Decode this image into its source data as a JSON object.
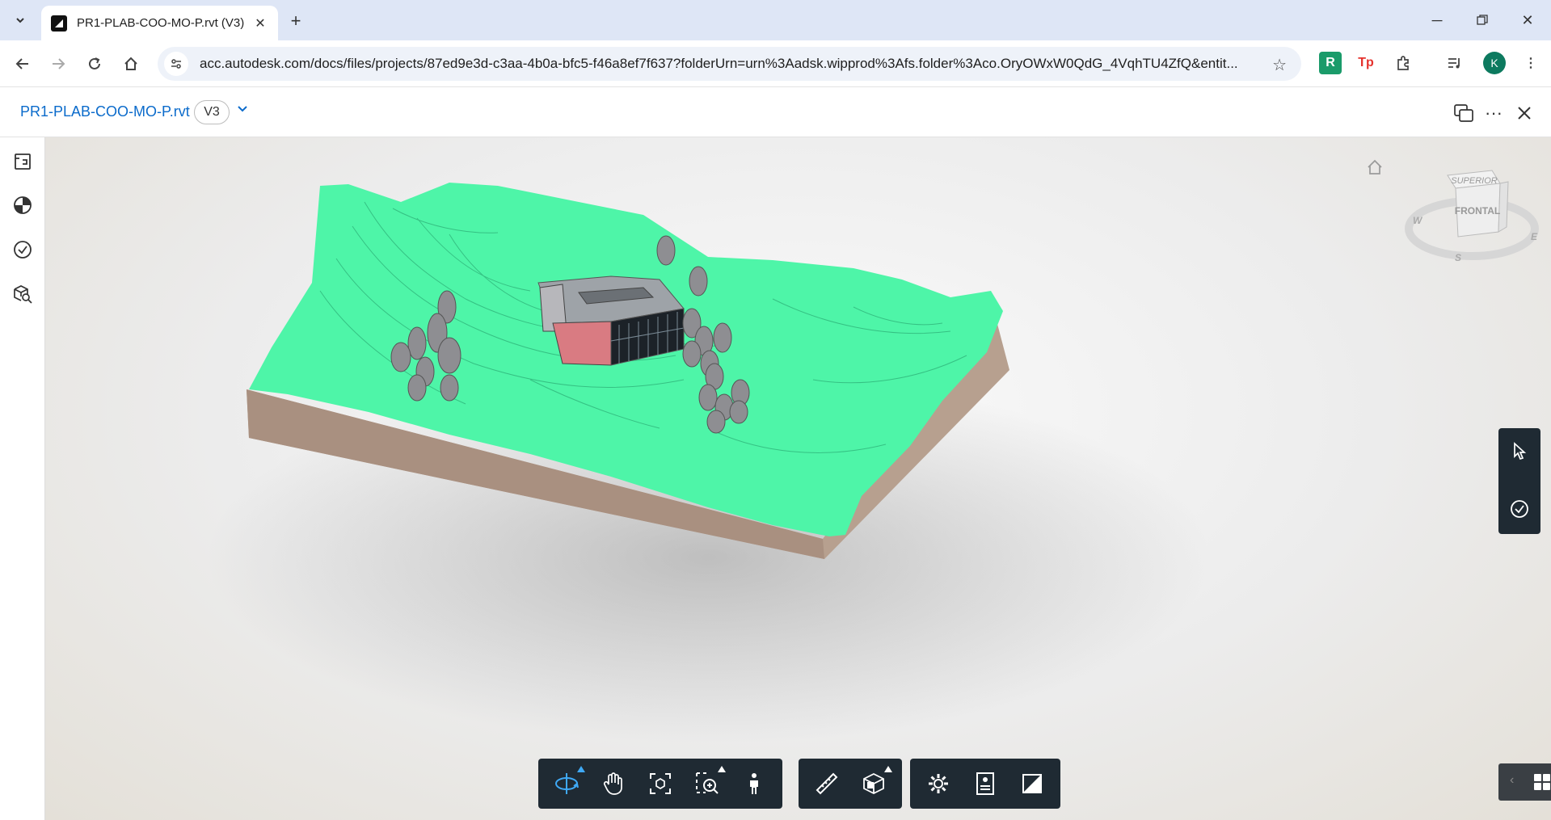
{
  "browser": {
    "tab_title": "PR1-PLAB-COO-MO-P.rvt (V3)",
    "url": "acc.autodesk.com/docs/files/projects/87ed9e3d-c3aa-4b0a-bfc5-f46a8ef7f637?folderUrn=urn%3Aadsk.wipprod%3Afs.folder%3Aco.OryOWxW0QdG_4VqhTU4ZfQ&entit...",
    "extensions": [
      "R",
      "Tp"
    ],
    "profile_initial": "K"
  },
  "app": {
    "file_name": "PR1-PLAB-COO-MO-P.rvt",
    "version": "V3"
  },
  "viewcube": {
    "top": "SUPERIOR",
    "front": "FRONTAL",
    "compass": [
      "W",
      "E",
      "S"
    ]
  },
  "colors": {
    "terrain": "#4ef5a8",
    "soil": "#b9a295",
    "toolbar": "#1f2a33",
    "accent": "#0b6bcb"
  }
}
